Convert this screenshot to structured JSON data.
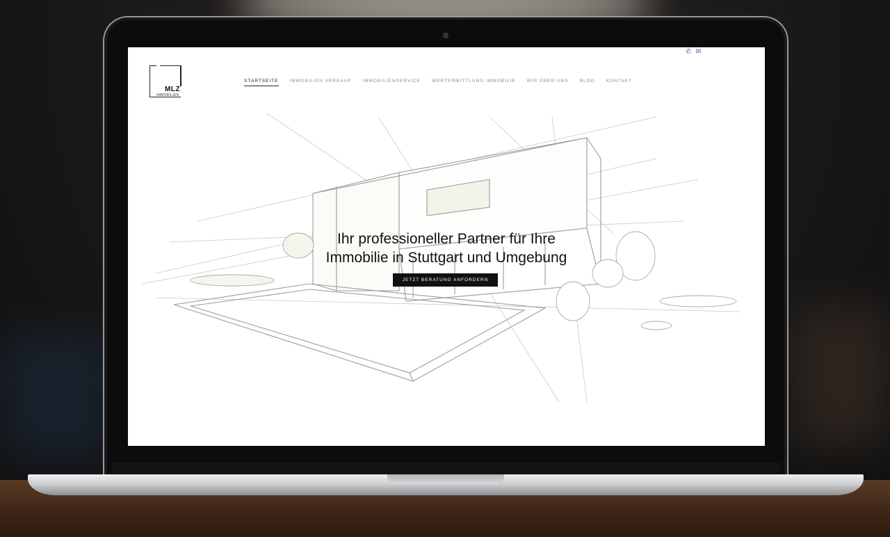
{
  "site": {
    "logo": {
      "name": "MLZ",
      "sub": "IMMOBILIEN"
    },
    "contact_icons": [
      "phone-icon",
      "mail-icon"
    ],
    "nav": {
      "items": [
        {
          "label": "STARTSEITE",
          "active": true
        },
        {
          "label": "IMMOBILIEN VERKAUF",
          "active": false
        },
        {
          "label": "IMMOBILIENSERVICE",
          "active": false
        },
        {
          "label": "WERTERMITTLUNG IMMOBILIE",
          "active": false
        },
        {
          "label": "WIR ÜBER UNS",
          "active": false
        },
        {
          "label": "BLOG",
          "active": false
        },
        {
          "label": "KONTAKT",
          "active": false
        }
      ]
    },
    "hero": {
      "headline_line1": "Ihr professioneller Partner für Ihre",
      "headline_line2": "Immobilie in Stuttgart und Umgebung",
      "cta_label": "JETZT BERATUNG ANFORDERN"
    }
  },
  "colors": {
    "accent": "#111111",
    "nav_inactive": "#8a8a8a",
    "icon_blue": "#5a6bb0"
  }
}
